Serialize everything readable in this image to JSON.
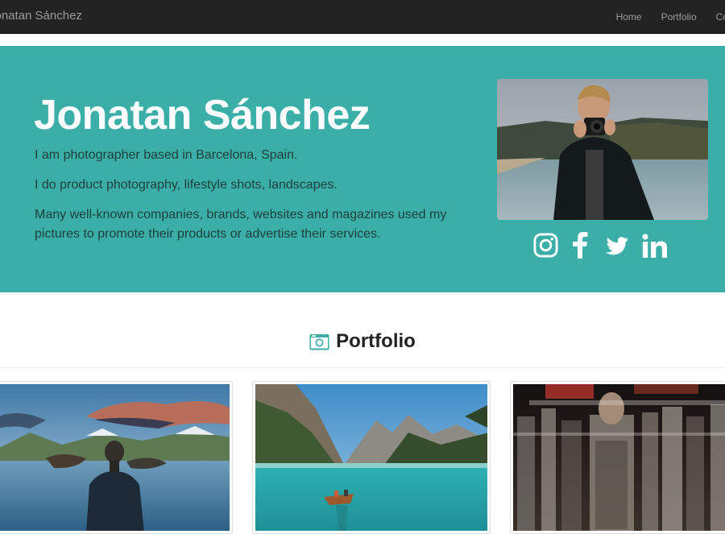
{
  "navbar": {
    "brand": "Jonatan Sánchez",
    "links": [
      "Home",
      "Portfolio",
      "Contact"
    ]
  },
  "hero": {
    "title": "Jonatan Sánchez",
    "paragraphs": [
      "I am photographer based in Barcelona, Spain.",
      "I do product photography, lifestyle shots, landscapes.",
      "Many well-known companies, brands, websites and magazines used my pictures to promote their products or advertise their services."
    ],
    "social_icons": [
      "instagram-icon",
      "facebook-icon",
      "twitter-icon",
      "linkedin-icon"
    ]
  },
  "portfolio": {
    "heading": "Portfolio",
    "icon": "camera-icon",
    "items": [
      "lake-person",
      "mountain-lake-boat",
      "crowd-motion"
    ]
  },
  "colors": {
    "navbar_bg": "#222222",
    "hero_bg": "#3aaea7",
    "nav_text": "#9d9d9d",
    "heading_text": "#222222"
  }
}
